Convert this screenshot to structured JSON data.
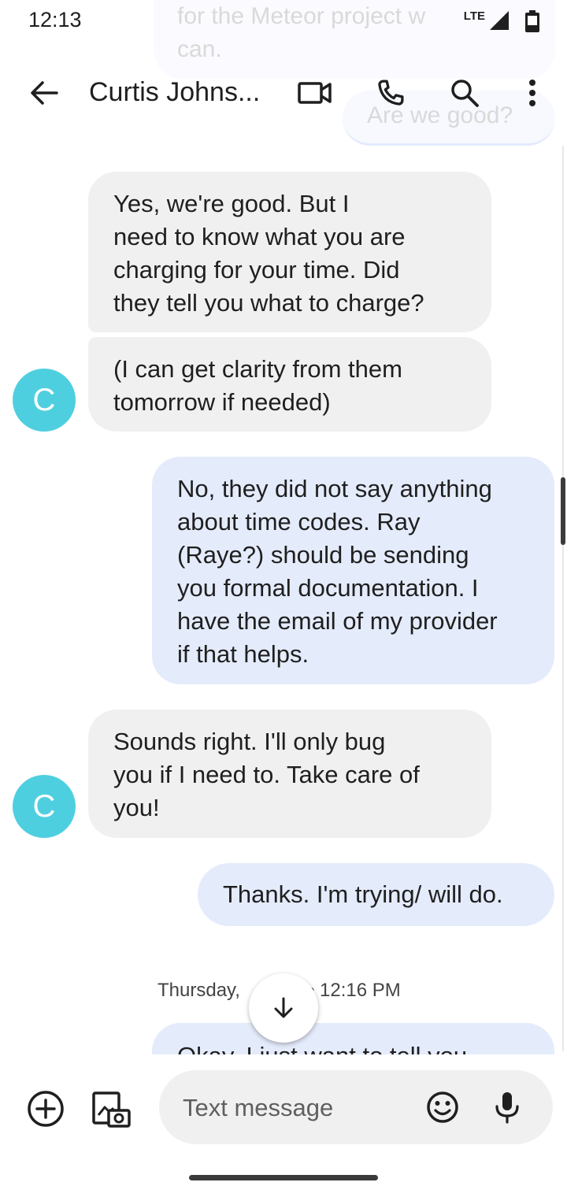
{
  "status_bar": {
    "time": "12:13",
    "network": "LTE"
  },
  "background_faded": {
    "line1": "for the Meteor project w",
    "line2": "can.",
    "line3": "Are we good?"
  },
  "app_bar": {
    "contact_name": "Curtis Johns...",
    "icons": [
      "back-arrow-icon",
      "video-call-icon",
      "phone-icon",
      "search-icon",
      "more-vert-icon"
    ]
  },
  "avatar_letter": "C",
  "messages": [
    {
      "direction": "received",
      "lines": [
        "Yes, we're good.  But I",
        "need to know what you are",
        "charging for your time.  Did",
        "they tell you what to charge?"
      ]
    },
    {
      "direction": "received",
      "lines": [
        "(I can get clarity from them",
        "tomorrow if needed)"
      ]
    },
    {
      "direction": "sent",
      "lines": [
        "No, they did not say anything",
        "about time codes. Ray",
        "(Raye?) should be sending",
        "you formal documentation. I",
        "have the email of my provider",
        "if that helps."
      ]
    },
    {
      "direction": "received",
      "lines": [
        "Sounds right.  I'll only bug",
        "you if I need to.  Take care of",
        "you!"
      ]
    },
    {
      "direction": "sent",
      "lines": [
        "Thanks. I'm trying/ will do."
      ]
    },
    {
      "direction": "sent",
      "lines": [
        "Okay. I just want to tell you"
      ]
    }
  ],
  "date_separator": {
    "day": "Thursday,",
    "time": "• 12:16 PM"
  },
  "composer": {
    "placeholder": "Text message"
  },
  "colors": {
    "avatar": "#4ecfe0",
    "received_bubble": "#f0f0f0",
    "sent_bubble": "#e4ebfb"
  }
}
